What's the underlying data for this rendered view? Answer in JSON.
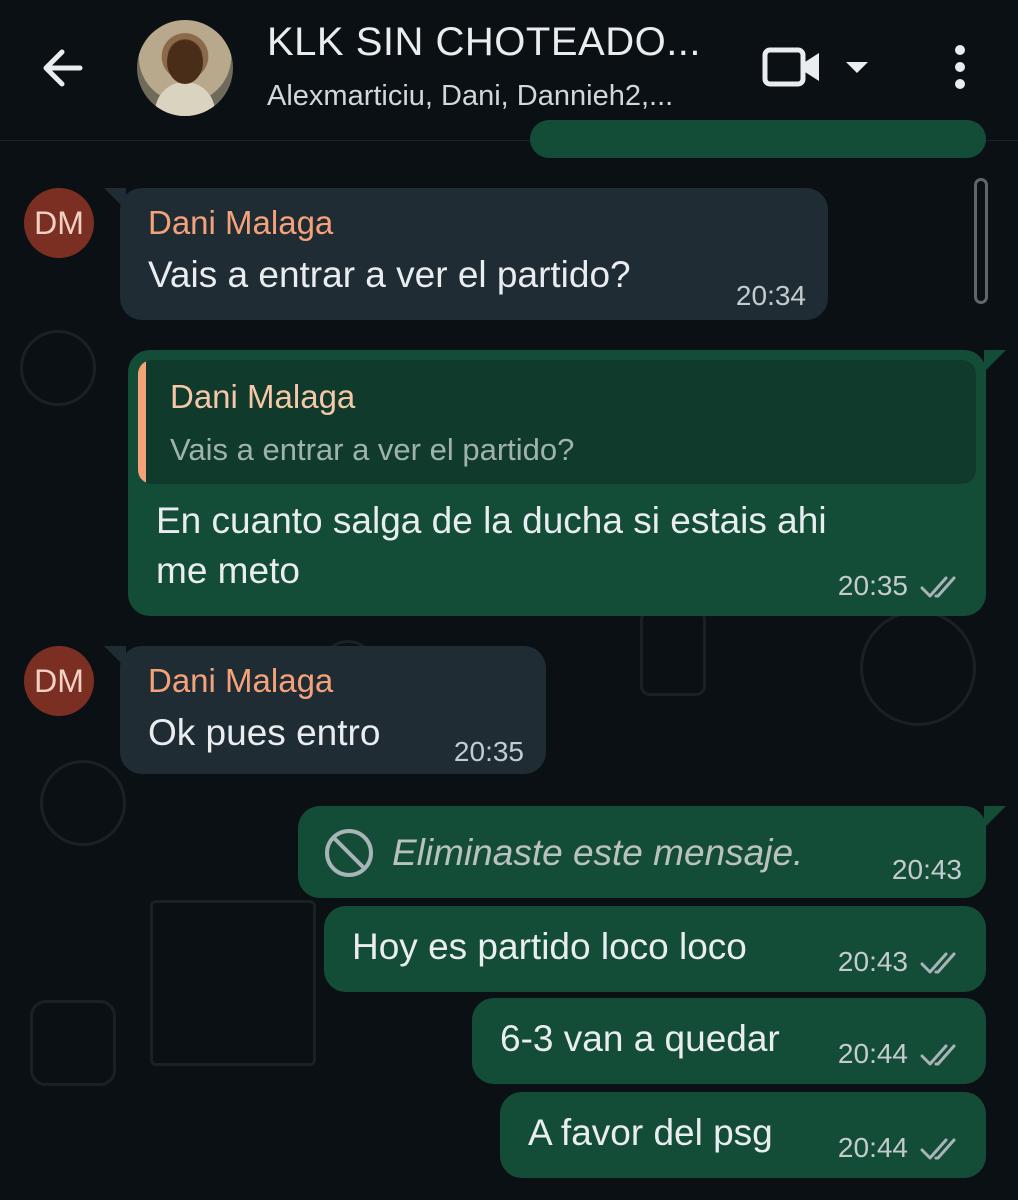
{
  "header": {
    "title": "KLK SIN CHOTEADO...",
    "participants": "Alexmarticiu, Dani, Dannieh2,..."
  },
  "messages": [
    {
      "sender_initials": "DM",
      "sender": "Dani Malaga",
      "text": "Vais a entrar a ver el partido?",
      "time": "20:34"
    },
    {
      "reply_sender": "Dani Malaga",
      "reply_text": "Vais a entrar a ver el partido?",
      "text_line1": "En cuanto salga de la ducha si estais ahi",
      "text_line2": "me meto",
      "time": "20:35"
    },
    {
      "sender_initials": "DM",
      "sender": "Dani Malaga",
      "text": "Ok pues entro",
      "time": "20:35"
    },
    {
      "text": "Eliminaste este mensaje.",
      "time": "20:43"
    },
    {
      "text": "Hoy es partido loco loco",
      "time": "20:43"
    },
    {
      "text": "6-3 van a quedar",
      "time": "20:44"
    },
    {
      "text": "A favor del psg",
      "time": "20:44"
    }
  ],
  "colors": {
    "background": "#0b1014",
    "incoming_bubble": "#202c33",
    "outgoing_bubble": "#144d37",
    "sender_name": "#f5a17a",
    "read_ticks": "#a9b4b8"
  }
}
